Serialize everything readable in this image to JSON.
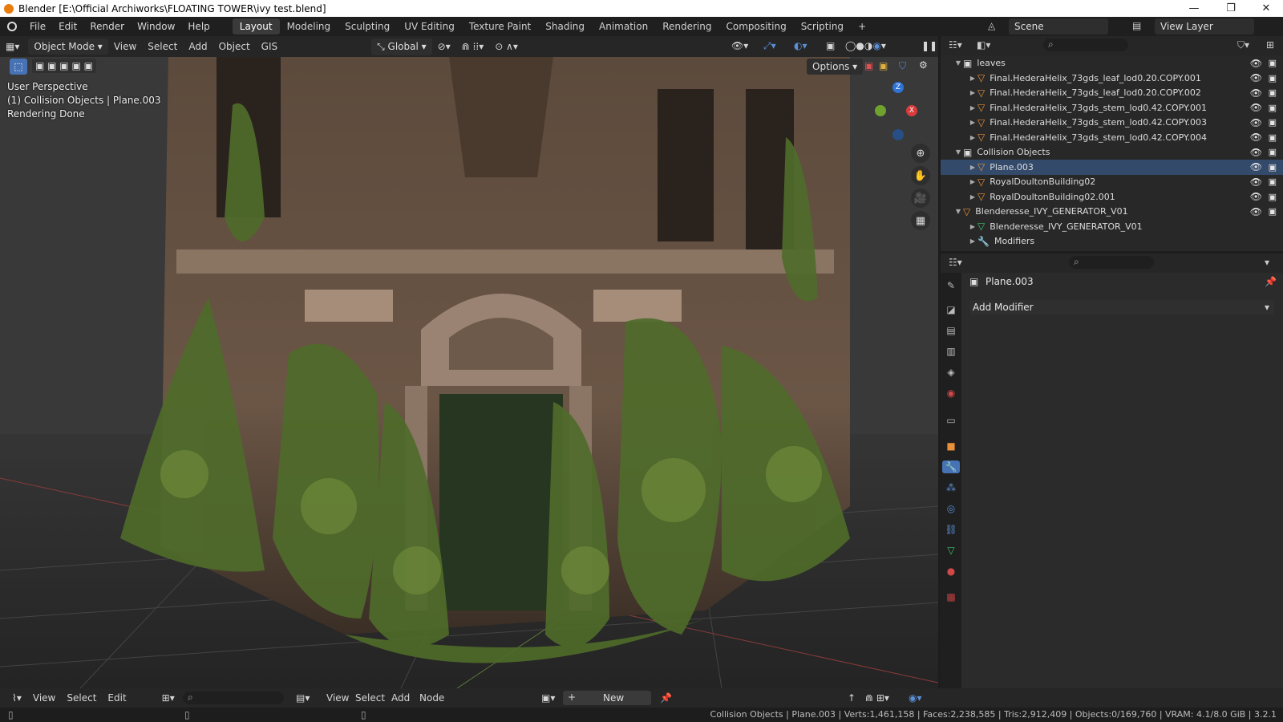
{
  "titlebar": {
    "title": "Blender [E:\\Official Archiworks\\FLOATING TOWER\\ivy test.blend]",
    "minimize": "—",
    "maximize": "❐",
    "close": "✕"
  },
  "menu": [
    "File",
    "Edit",
    "Render",
    "Window",
    "Help"
  ],
  "workspaces": [
    "Layout",
    "Modeling",
    "Sculpting",
    "UV Editing",
    "Texture Paint",
    "Shading",
    "Animation",
    "Rendering",
    "Compositing",
    "Scripting"
  ],
  "active_workspace": "Layout",
  "scene": {
    "label": "Scene"
  },
  "view_layer": {
    "label": "View Layer"
  },
  "viewport_header": {
    "mode": "Object Mode",
    "menus": [
      "View",
      "Select",
      "Add",
      "Object",
      "GIS"
    ],
    "transform": "Global",
    "options": "Options"
  },
  "viewport_overlay": {
    "perspective": "User Perspective",
    "collection": "(1) Collision Objects | Plane.003",
    "render_status": "Rendering Done"
  },
  "gizmo": {
    "z": "Z",
    "x": "X"
  },
  "outliner": {
    "rows": [
      {
        "label": "leaves",
        "level": 1,
        "kind": "collection"
      },
      {
        "label": "Final.HederaHelix_73gds_leaf_lod0.20.COPY.001",
        "level": 2,
        "kind": "mesh"
      },
      {
        "label": "Final.HederaHelix_73gds_leaf_lod0.20.COPY.002",
        "level": 2,
        "kind": "mesh"
      },
      {
        "label": "Final.HederaHelix_73gds_stem_lod0.42.COPY.001",
        "level": 2,
        "kind": "mesh"
      },
      {
        "label": "Final.HederaHelix_73gds_stem_lod0.42.COPY.003",
        "level": 2,
        "kind": "mesh"
      },
      {
        "label": "Final.HederaHelix_73gds_stem_lod0.42.COPY.004",
        "level": 2,
        "kind": "mesh"
      },
      {
        "label": "Collision Objects",
        "level": 1,
        "kind": "collection"
      },
      {
        "label": "Plane.003",
        "level": 2,
        "kind": "mesh"
      },
      {
        "label": "RoyalDoultonBuilding02",
        "level": 2,
        "kind": "mesh"
      },
      {
        "label": "RoyalDoultonBuilding02.001",
        "level": 2,
        "kind": "mesh"
      },
      {
        "label": "Blenderesse_IVY_GENERATOR_V01",
        "level": 1,
        "kind": "mesh"
      },
      {
        "label": "Blenderesse_IVY_GENERATOR_V01",
        "level": 2,
        "kind": "data"
      },
      {
        "label": "Modifiers",
        "level": 2,
        "kind": "modifier"
      }
    ]
  },
  "properties": {
    "object_name": "Plane.003",
    "add_modifier": "Add Modifier"
  },
  "bottom_bar": {
    "left_menus": [
      "View",
      "Select",
      "Edit"
    ],
    "node_menus": [
      "View",
      "Select",
      "Add",
      "Node"
    ],
    "new_label": "New"
  },
  "status": "Collision Objects | Plane.003 | Verts:1,461,158 | Faces:2,238,585 | Tris:2,912,409 | Objects:0/169,760 | VRAM: 4.1/8.0 GiB | 3.2.1",
  "colors": {
    "accent": "#4772b3",
    "object_orange": "#e8913a",
    "ivy_green": "#4f6b2a"
  }
}
